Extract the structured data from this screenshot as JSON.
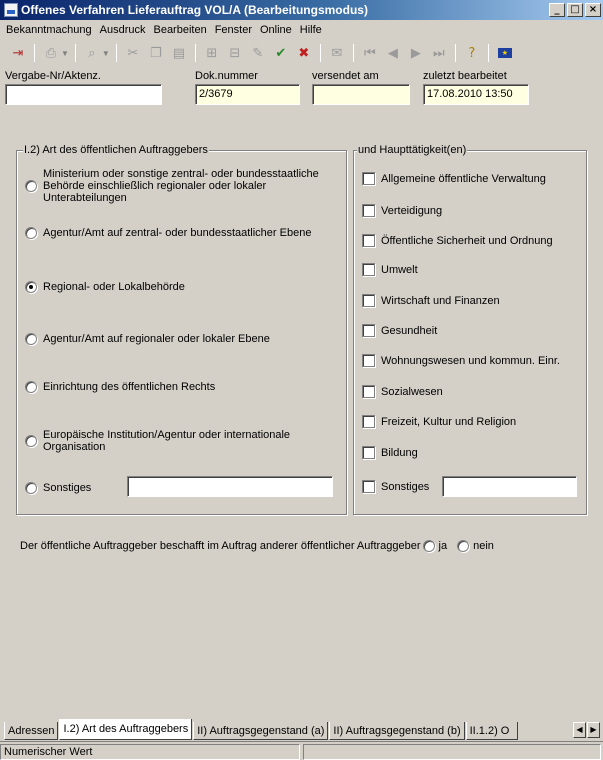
{
  "window": {
    "title": "Offenes Verfahren Lieferauftrag VOL/A (Bearbeitungsmodus)",
    "minimize": "_",
    "maximize": "□",
    "close": "×"
  },
  "menu": [
    "Bekanntmachung",
    "Ausdruck",
    "Bearbeiten",
    "Fenster",
    "Online",
    "Hilfe"
  ],
  "header": {
    "vergabe_label": "Vergabe-Nr/Aktenz.",
    "vergabe_value": "",
    "dok_label": "Dok.nummer",
    "dok_value": "2/3679",
    "versendet_label": "versendet am",
    "versendet_value": "",
    "zuletzt_label": "zuletzt bearbeitet",
    "zuletzt_value": "17.08.2010 13:50"
  },
  "auftraggeber": {
    "title": "I.2) Art des öffentlichen Auftraggebers",
    "options": [
      {
        "label": "Ministerium oder sonstige zentral- oder bundesstaatliche Behörde einschließlich regionaler oder lokaler Unterabteilungen",
        "selected": false
      },
      {
        "label": "Agentur/Amt auf zentral- oder bundesstaatlicher Ebene",
        "selected": false
      },
      {
        "label": "Regional- oder Lokalbehörde",
        "selected": true
      },
      {
        "label": "Agentur/Amt auf regionaler oder lokaler Ebene",
        "selected": false
      },
      {
        "label": "Einrichtung des öffentlichen Rechts",
        "selected": false
      },
      {
        "label": "Europäische Institution/Agentur oder internationale Organisation",
        "selected": false
      },
      {
        "label": "Sonstiges",
        "selected": false
      }
    ],
    "sonstiges_value": ""
  },
  "taetigkeit": {
    "title": "und Haupttätigkeit(en)",
    "items": [
      {
        "label": "Allgemeine öffentliche Verwaltung",
        "checked": false
      },
      {
        "label": "Verteidigung",
        "checked": false
      },
      {
        "label": "Öffentliche Sicherheit und Ordnung",
        "checked": false
      },
      {
        "label": "Umwelt",
        "checked": false
      },
      {
        "label": "Wirtschaft und Finanzen",
        "checked": false
      },
      {
        "label": "Gesundheit",
        "checked": false
      },
      {
        "label": "Wohnungswesen und kommun. Einr.",
        "checked": false
      },
      {
        "label": "Sozialwesen",
        "checked": false
      },
      {
        "label": "Freizeit, Kultur und Religion",
        "checked": false
      },
      {
        "label": "Bildung",
        "checked": false
      },
      {
        "label": "Sonstiges",
        "checked": false
      }
    ],
    "sonstiges_value": ""
  },
  "beschafft": {
    "question": "Der öffentliche Auftraggeber beschafft im Auftrag anderer öffentlicher Auftraggeber",
    "ja": "ja",
    "nein": "nein"
  },
  "tabs": [
    {
      "label": "Adressen",
      "active": false
    },
    {
      "label": "I.2) Art des Auftraggebers",
      "active": true
    },
    {
      "label": "II) Auftragsgegenstand (a)",
      "active": false
    },
    {
      "label": "II) Auftragsgegenstand (b)",
      "active": false
    },
    {
      "label": "II.1.2) O",
      "active": false
    }
  ],
  "status": {
    "text": "Numerischer Wert"
  }
}
